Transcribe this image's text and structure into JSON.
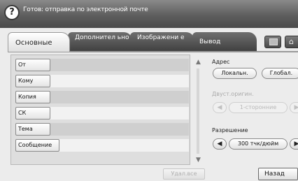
{
  "header": {
    "help_glyph": "?",
    "status": "Готов: отправка по электронной почте"
  },
  "tabs": [
    {
      "label": "Основные",
      "active": true
    },
    {
      "label": "Дополнител ьно",
      "active": false
    },
    {
      "label": "Изображени е",
      "active": false
    },
    {
      "label": "Вывод",
      "active": false
    }
  ],
  "toolbar_icons": [
    "window-icon",
    "home-icon"
  ],
  "fields": [
    {
      "label": "От"
    },
    {
      "label": "Кому"
    },
    {
      "label": "Копия"
    },
    {
      "label": "СК"
    },
    {
      "label": "Тема"
    },
    {
      "label": "Сообщение"
    }
  ],
  "scroll": {
    "up": "▲",
    "down": "▼"
  },
  "delete_label": "Удал.все",
  "address": {
    "label": "Адрес",
    "local": "Локальн.",
    "global": "Глобал."
  },
  "duplex": {
    "label": "Двуст.оригин.",
    "value": "1-сторонние",
    "enabled": false
  },
  "resolution": {
    "label": "Разрешение",
    "value": "300 тчк/дюйм"
  },
  "arrows": {
    "left": "◀",
    "right": "▶"
  },
  "back_label": "Назад",
  "colors": {
    "header_dark": "#4a4a4a",
    "panel_bg": "#ececec",
    "row_dark": "#cfcfcf",
    "row_light": "#f2f2f2"
  }
}
